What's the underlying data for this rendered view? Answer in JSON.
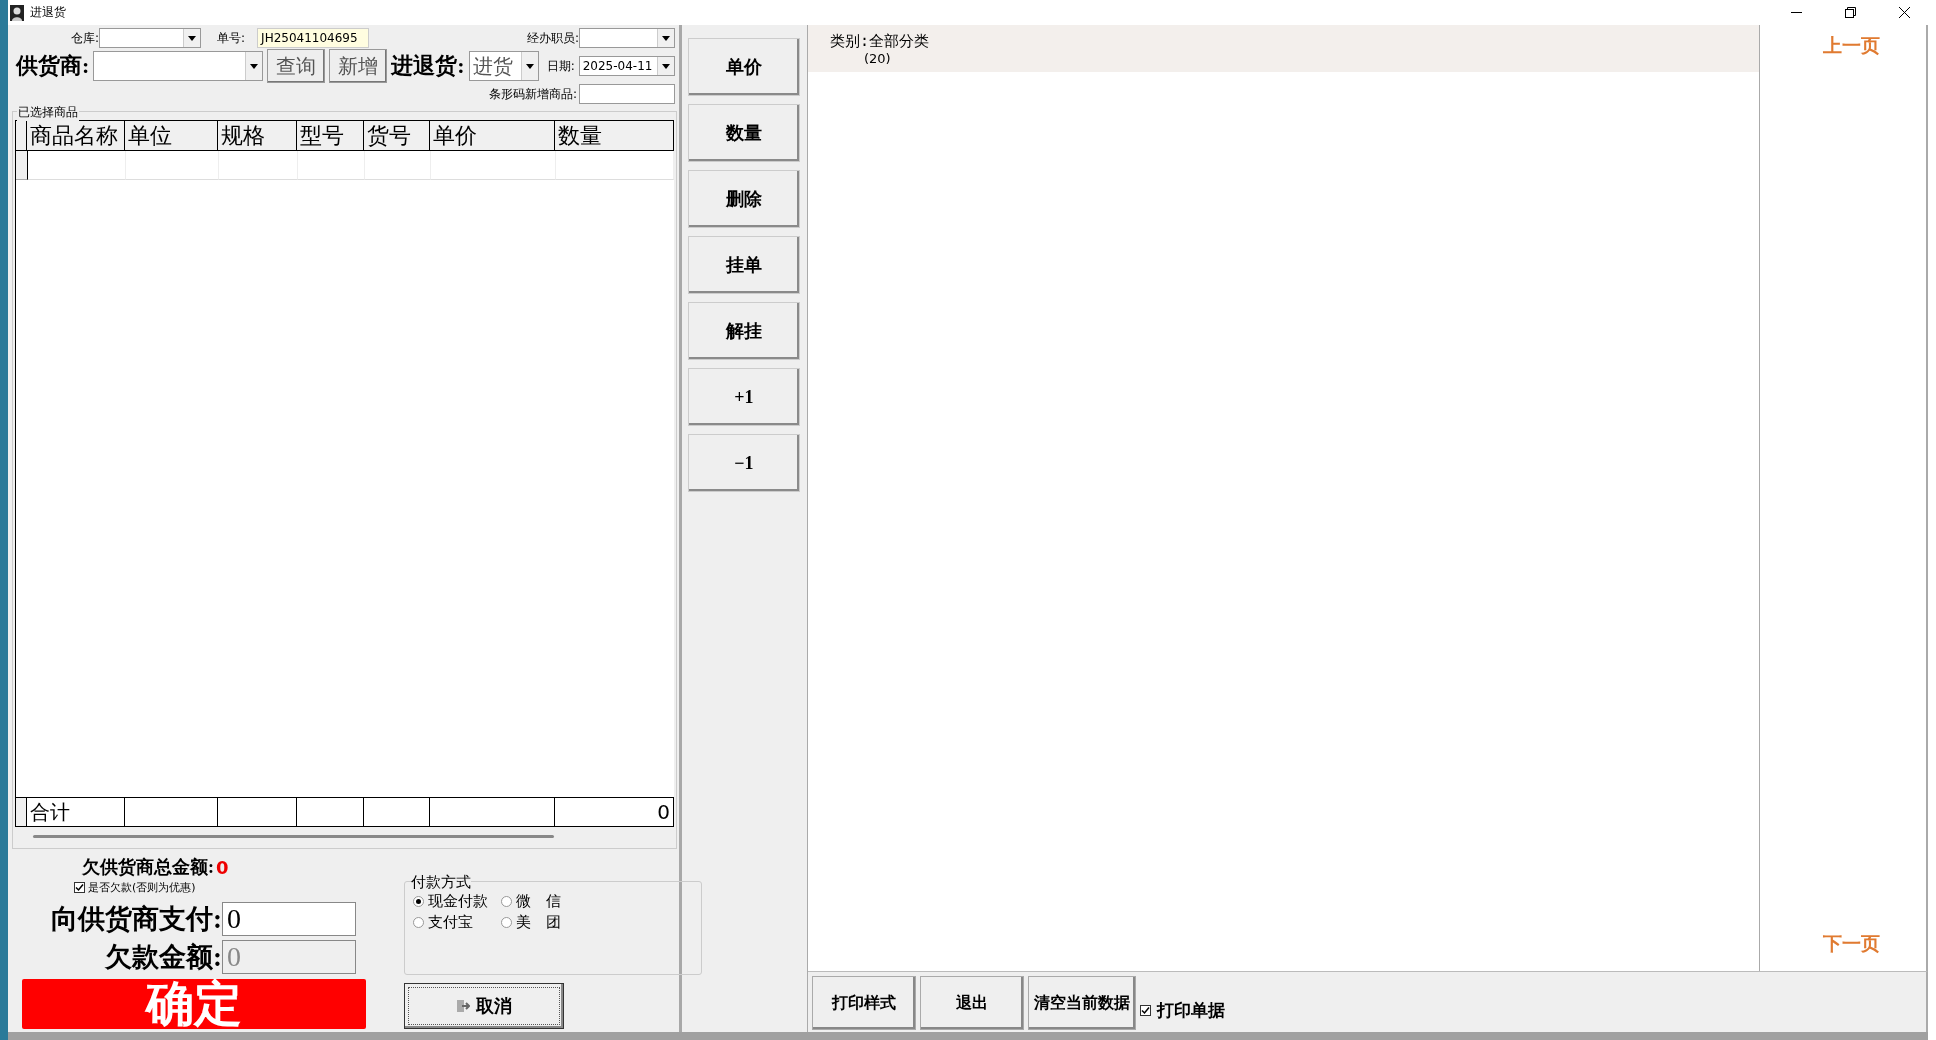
{
  "window": {
    "title": "进退货"
  },
  "form": {
    "warehouse": {
      "label": "仓库:"
    },
    "order_no": {
      "label": "单号:",
      "value": "JH25041104695"
    },
    "handler": {
      "label": "经办职员:"
    },
    "supplier": {
      "label": "供货商:"
    },
    "buttons": [
      "查询",
      "新增"
    ],
    "direction": {
      "label": "进退货:",
      "value": "进货"
    },
    "date": {
      "label": "日期:",
      "value": "2025-04-11"
    },
    "barcode": {
      "label": "条形码新增商品:"
    }
  },
  "goods": {
    "title": "已选择商品",
    "columns": [
      "商品名称",
      "单位",
      "规格",
      "型号",
      "货号",
      "单价",
      "数量"
    ],
    "total_row": {
      "label": "合计",
      "quantity": "0"
    }
  },
  "debt": {
    "total_label": "欠供货商总金额:",
    "total_value": "0",
    "is_debt": {
      "label": "是否欠款(否则为优惠)",
      "checked": true
    },
    "pay": {
      "label": "向供货商支付:",
      "value": "0"
    },
    "owed": {
      "label": "欠款金额:",
      "value": "0",
      "disabled": true
    }
  },
  "payment": {
    "title": "付款方式",
    "options": [
      {
        "label": "现金付款",
        "selected": true
      },
      {
        "label": "微　信",
        "selected": false
      },
      {
        "label": "支付宝",
        "selected": false
      },
      {
        "label": "美　团",
        "selected": false
      }
    ]
  },
  "confirm_button": "确定",
  "cancel_button": "取消",
  "action_buttons": [
    "单价",
    "数量",
    "删除",
    "挂单",
    "解挂",
    "+1",
    "−1"
  ],
  "category": {
    "label": "类别:全部分类",
    "count": "(20)"
  },
  "pager": {
    "prev": "上一页",
    "next": "下一页"
  },
  "bottom_buttons": [
    "打印样式",
    "退出",
    "清空当前数据"
  ],
  "print_receipt": {
    "label": "打印单据",
    "checked": true
  }
}
